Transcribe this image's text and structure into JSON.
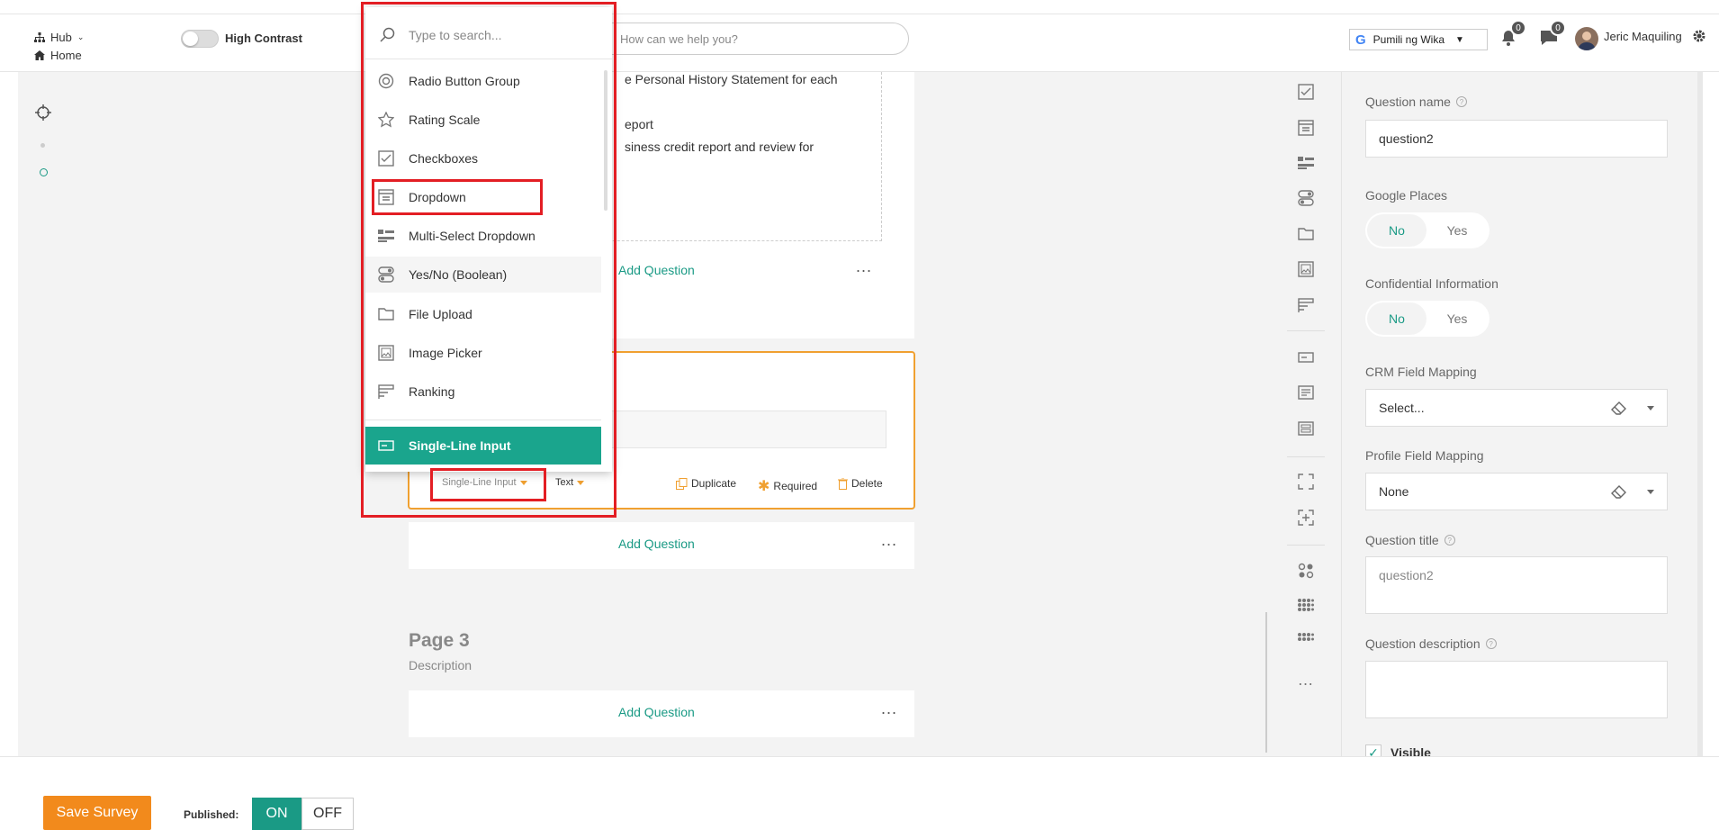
{
  "topbar": {
    "hub_label": "Hub",
    "home_label": "Home",
    "high_contrast_label": "High Contrast",
    "search_placeholder": "How can we help you?",
    "language_label": "Pumili ng Wika",
    "notifications_count": "0",
    "messages_count": "0",
    "user_name": "Jeric Maquiling"
  },
  "survey": {
    "card1_lines": [
      "e Personal History Statement for each",
      "eport",
      "siness credit report and review for"
    ],
    "add_question": "Add Question",
    "more": "...",
    "question_type": "Single-Line Input",
    "input_type": "Text",
    "duplicate_label": "Duplicate",
    "required_label": "Required",
    "delete_label": "Delete",
    "page3_title": "Page 3",
    "page3_description": "Description"
  },
  "dropdown": {
    "search_placeholder": "Type to search...",
    "items": [
      {
        "label": "Radio Button Group",
        "icon": "radio-icon"
      },
      {
        "label": "Rating Scale",
        "icon": "star-icon"
      },
      {
        "label": "Checkboxes",
        "icon": "checkbox-icon"
      },
      {
        "label": "Dropdown",
        "icon": "dropdown-icon"
      },
      {
        "label": "Multi-Select Dropdown",
        "icon": "multiselect-icon"
      },
      {
        "label": "Yes/No (Boolean)",
        "icon": "boolean-icon"
      },
      {
        "label": "File Upload",
        "icon": "folder-icon"
      },
      {
        "label": "Image Picker",
        "icon": "image-icon"
      },
      {
        "label": "Ranking",
        "icon": "ranking-icon"
      }
    ],
    "selected": "Single-Line Input"
  },
  "properties": {
    "question_name_label": "Question name",
    "question_name_value": "question2",
    "google_places_label": "Google Places",
    "confidential_label": "Confidential Information",
    "no_label": "No",
    "yes_label": "Yes",
    "crm_label": "CRM Field Mapping",
    "crm_value": "Select...",
    "profile_label": "Profile Field Mapping",
    "profile_value": "None",
    "question_title_label": "Question title",
    "question_title_value": "question2",
    "question_description_label": "Question description",
    "question_description_value": "",
    "visible_label": "Visible"
  },
  "bottombar": {
    "save_label": "Save Survey",
    "published_label": "Published:",
    "on_label": "ON",
    "off_label": "OFF"
  },
  "colors": {
    "accent": "#1a9a85",
    "save_orange": "#f28a1c",
    "highlight_red": "#e31e24",
    "card_border": "#f0a030"
  }
}
